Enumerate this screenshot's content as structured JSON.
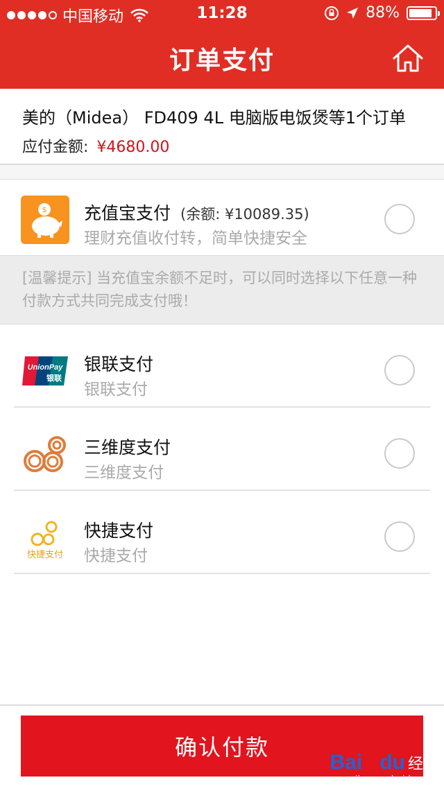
{
  "status_bar": {
    "carrier": "中国移动",
    "time": "11:28",
    "battery": "88%",
    "battery_level": 0.88
  },
  "nav": {
    "title": "订单支付",
    "home_icon": "home-icon"
  },
  "order": {
    "title": "美的（Midea） FD409 4L 电脑版电饭煲等1个订单",
    "amount_label": "应付金额:",
    "amount_value": "¥4680.00"
  },
  "payments": [
    {
      "name": "充值宝支付",
      "balance": "(余额: ¥10089.35)",
      "desc": "理财充值收付转，简单快捷安全",
      "icon": "piggy-bank-icon"
    },
    {
      "name": "银联支付",
      "desc": "银联支付",
      "icon": "unionpay-icon"
    },
    {
      "name": "三维度支付",
      "desc": "三维度支付",
      "icon": "sanweidu-icon"
    },
    {
      "name": "快捷支付",
      "desc": "快捷支付",
      "icon": "quickpay-icon"
    }
  ],
  "tip": "[温馨提示] 当充值宝余额不足时，可以同时选择以下任意一种付款方式共同完成支付哦！",
  "icon_text": {
    "unionpay": "UnionPay",
    "unionpay_cn": "银联",
    "quickpay": "快捷支付"
  },
  "confirm_button": "确认付款",
  "watermark": {
    "logo_a": "Bai",
    "logo_b": "du",
    "sub": "经验",
    "url": "jingyan.baidu.com"
  },
  "colors": {
    "brand": "#e02e24",
    "button": "#e2141e",
    "amount": "#d0131c",
    "orange": "#f7931e"
  }
}
